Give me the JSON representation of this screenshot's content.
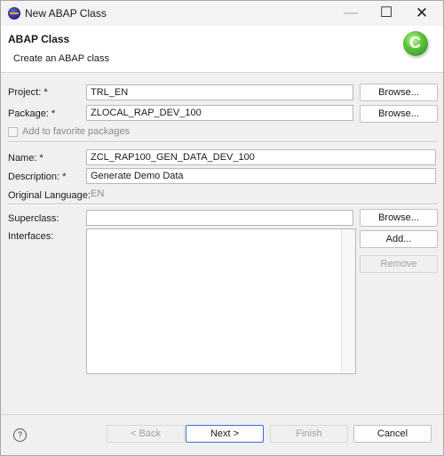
{
  "window": {
    "title": "New ABAP Class",
    "minimize": "—",
    "maximize": "☐",
    "close": "✕"
  },
  "banner": {
    "title": "ABAP Class",
    "description": "Create an ABAP class"
  },
  "form": {
    "project_label": "Project: *",
    "project_value": "TRL_EN",
    "package_label": "Package: *",
    "package_value": "ZLOCAL_RAP_DEV_100",
    "favorite_label": "Add to favorite packages",
    "favorite_checked": false,
    "name_label": "Name: *",
    "name_value": "ZCL_RAP100_GEN_DATA_DEV_100",
    "description_label": "Description: *",
    "description_value": "Generate Demo Data",
    "original_language_label": "Original Language:",
    "original_language_value": "EN",
    "superclass_label": "Superclass:",
    "superclass_value": "",
    "interfaces_label": "Interfaces:"
  },
  "buttons": {
    "browse_project": "Browse...",
    "browse_package": "Browse...",
    "browse_superclass": "Browse...",
    "add": "Add...",
    "remove": "Remove"
  },
  "footer": {
    "help": "?",
    "back": "< Back",
    "next": "Next >",
    "finish": "Finish",
    "cancel": "Cancel"
  }
}
